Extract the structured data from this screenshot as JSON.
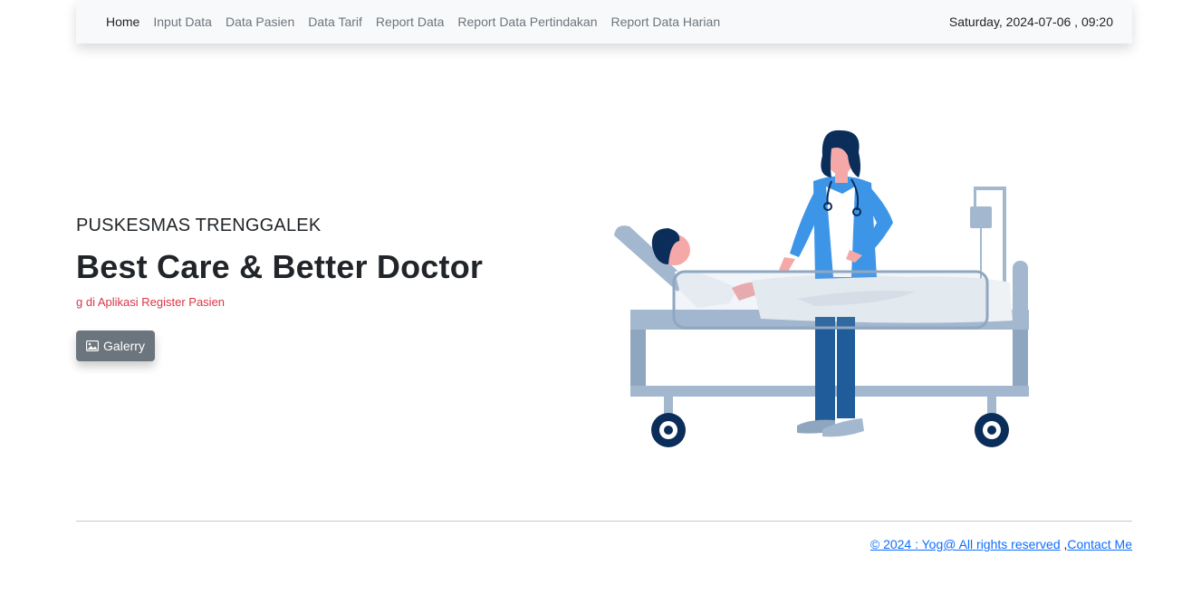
{
  "nav": {
    "items": [
      {
        "label": "Home",
        "active": true
      },
      {
        "label": "Input Data"
      },
      {
        "label": "Data Pasien"
      },
      {
        "label": "Data Tarif"
      },
      {
        "label": "Report Data"
      },
      {
        "label": "Report Data Pertindakan"
      },
      {
        "label": "Report Data Harian"
      }
    ],
    "datetime": "Saturday, 2024-07-06 , 09:20"
  },
  "hero": {
    "subtitle": "PUSKESMAS TRENGGALEK",
    "title": "Best Care & Better Doctor",
    "marquee": "g di Aplikasi Register Pasien",
    "gallery_button": "Galerry",
    "gallery_icon": "image-icon"
  },
  "illustration": {
    "icon": "doctor-patient-illustration"
  },
  "footer": {
    "copyright": "© 2024 : Yog@ All rights reserved",
    "separator": " ,",
    "contact": "Contact Me"
  },
  "colors": {
    "navbar_bg": "#f8f9fa",
    "accent_red": "#dc3545",
    "button_gray": "#6c757d",
    "link_blue": "#0d6efd"
  }
}
